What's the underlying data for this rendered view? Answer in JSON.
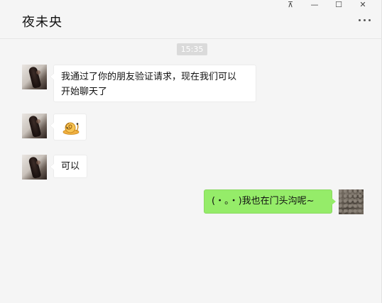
{
  "window": {
    "pin_glyph": "⊼",
    "minimize_glyph": "—",
    "maximize_glyph": "☐",
    "close_glyph": "✕"
  },
  "chat": {
    "contact_name": "夜未央",
    "timestamp": "15:35",
    "messages": [
      {
        "side": "left",
        "type": "text",
        "text": "我通过了你的朋友验证请求，现在我们可以\n开始聊天了"
      },
      {
        "side": "left",
        "type": "emoji",
        "icon": "snail-emoji"
      },
      {
        "side": "left",
        "type": "text",
        "text": "可以"
      },
      {
        "side": "right",
        "type": "text",
        "text": "(・。・)我也在门头沟呢~"
      }
    ]
  },
  "colors": {
    "sent_bubble": "#95ec69",
    "received_bubble": "#ffffff",
    "background": "#f5f5f5",
    "timestamp_bg": "#dadada"
  }
}
